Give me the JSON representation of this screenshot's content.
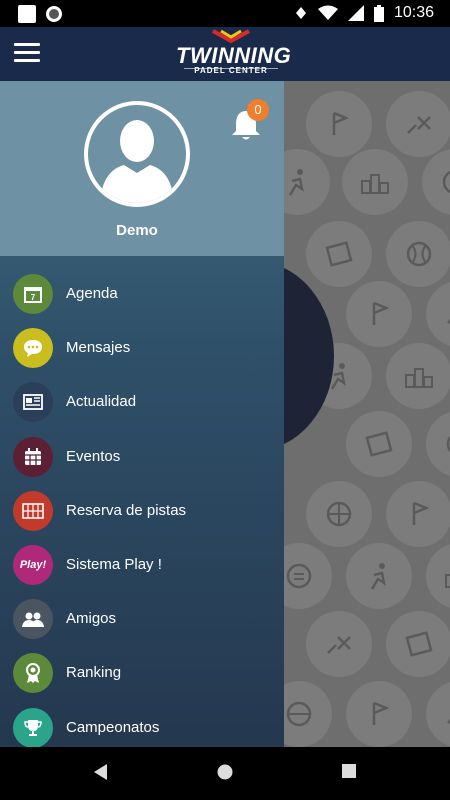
{
  "status_bar": {
    "time": "10:36"
  },
  "app_bar": {
    "brand_name": "TWINNING",
    "brand_tagline": "PADEL CENTER"
  },
  "profile": {
    "name": "Demo",
    "notifications_count": "0"
  },
  "menu": {
    "items": [
      {
        "label": "Agenda",
        "icon": "calendar-7-icon",
        "color": "#5d8a3a"
      },
      {
        "label": "Mensajes",
        "icon": "chat-bubble-icon",
        "color": "#c9bd1f"
      },
      {
        "label": "Actualidad",
        "icon": "newspaper-icon",
        "color": "#2b3f58"
      },
      {
        "label": "Eventos",
        "icon": "calendar-grid-icon",
        "color": "#5c1f33"
      },
      {
        "label": "Reserva de pistas",
        "icon": "court-icon",
        "color": "#c23a2a"
      },
      {
        "label": "Sistema Play !",
        "icon": "play-badge-icon",
        "color": "#b0287a",
        "badge_text": "Play!"
      },
      {
        "label": "Amigos",
        "icon": "friends-icon",
        "color": "#4a5560"
      },
      {
        "label": "Ranking",
        "icon": "medal-icon",
        "color": "#5d8a3a"
      },
      {
        "label": "Campeonatos",
        "icon": "trophy-icon",
        "color": "#2ba58a"
      }
    ]
  },
  "colors": {
    "app_bar": "#1a2a4a",
    "drawer_top": "#3f6b82",
    "drawer_bottom": "#24384f",
    "profile_bg": "#6e91a4",
    "badge": "#f07e2a"
  }
}
